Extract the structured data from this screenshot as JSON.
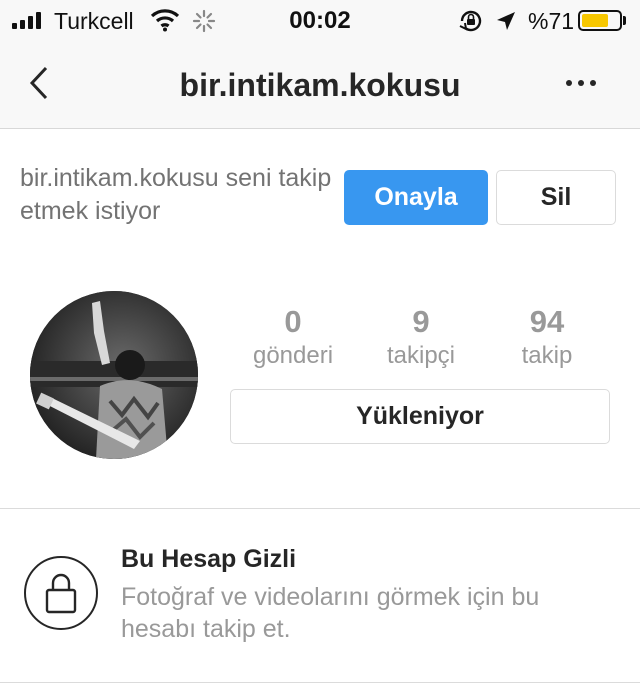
{
  "status_bar": {
    "carrier": "Turkcell",
    "time": "00:02",
    "battery_percent": "%71",
    "battery_level": 0.71,
    "battery_color": "#f7c700",
    "icons": [
      "signal-icon",
      "wifi-icon",
      "loading-spinner-icon",
      "rotation-lock-icon",
      "location-arrow-icon",
      "battery-icon"
    ]
  },
  "nav": {
    "title": "bir.intikam.kokusu",
    "back_icon": "chevron-left-icon",
    "more_icon": "more-horizontal-icon"
  },
  "follow_request": {
    "text": "bir.intikam.kokusu seni takip etmek istiyor",
    "approve_label": "Onayla",
    "delete_label": "Sil",
    "approve_color": "#3897f0"
  },
  "profile": {
    "stats": [
      {
        "value": "0",
        "label": "gönderi"
      },
      {
        "value": "9",
        "label": "takipçi"
      },
      {
        "value": "94",
        "label": "takip"
      }
    ],
    "action_label": "Yükleniyor"
  },
  "private_notice": {
    "title": "Bu Hesap Gizli",
    "description": "Fotoğraf ve videolarını görmek için bu hesabı takip et.",
    "icon": "lock-icon"
  }
}
